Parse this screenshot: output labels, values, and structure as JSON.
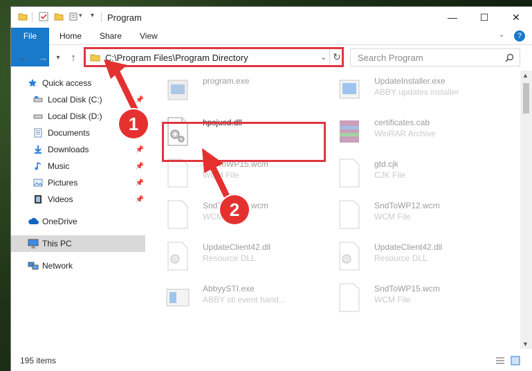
{
  "window": {
    "title": "Program",
    "minimize": "—",
    "maximize": "☐",
    "close": "✕"
  },
  "ribbon": {
    "tabs": [
      "File",
      "Home",
      "Share",
      "View"
    ],
    "help": "?"
  },
  "nav": {
    "back": "←",
    "forward": "→",
    "recent": "▾",
    "up": "↑",
    "address": "C:\\Program Files\\Program Directory",
    "search_placeholder": "Search Program"
  },
  "sidebar": {
    "items": [
      {
        "label": "Quick access",
        "icon": "star-icon"
      },
      {
        "label": "Local Disk (C:)",
        "icon": "drive-icon",
        "pinned": true
      },
      {
        "label": "Local Disk (D:)",
        "icon": "drive-icon",
        "pinned": false
      },
      {
        "label": "Documents",
        "icon": "documents-icon",
        "pinned": true
      },
      {
        "label": "Downloads",
        "icon": "download-icon",
        "pinned": true
      },
      {
        "label": "Music",
        "icon": "music-icon",
        "pinned": true
      },
      {
        "label": "Pictures",
        "icon": "pictures-icon",
        "pinned": true
      },
      {
        "label": "Videos",
        "icon": "videos-icon",
        "pinned": true
      },
      {
        "label": "OneDrive",
        "icon": "cloud-icon"
      },
      {
        "label": "This PC",
        "icon": "computer-icon",
        "selected": true
      },
      {
        "label": "Network",
        "icon": "network-icon"
      }
    ]
  },
  "files": [
    {
      "name": "program.exe",
      "desc": "",
      "icon": "exe-icon",
      "highlighted": false
    },
    {
      "name": "UpdateInstaller.exe",
      "desc": "ABBY updates installer",
      "icon": "installer-icon",
      "highlighted": false
    },
    {
      "name": "hpsjusd.dll",
      "desc": "",
      "icon": "dll-icon",
      "highlighted": true
    },
    {
      "name": "certificates.cab",
      "desc": "WinRAR Archive",
      "icon": "archive-icon",
      "highlighted": false
    },
    {
      "name": "SndToWP15.wcm",
      "desc": "WCM File",
      "icon": "file-icon",
      "highlighted": false
    },
    {
      "name": "gtd.cjk",
      "desc": "CJK File",
      "icon": "file-icon",
      "highlighted": false
    },
    {
      "name": "SndToWP12.wcm",
      "desc": "WCM File",
      "icon": "file-icon",
      "highlighted": false
    },
    {
      "name": "SndToWP12.wcm",
      "desc": "WCM File",
      "icon": "file-icon",
      "highlighted": false
    },
    {
      "name": "UpdateClient42.dll",
      "desc": "Resource DLL",
      "icon": "dll-icon",
      "highlighted": false
    },
    {
      "name": "UpdateClient42.dll",
      "desc": "Resource DLL",
      "icon": "dll-icon",
      "highlighted": false
    },
    {
      "name": "AbbyySTI.exe",
      "desc": "ABBY sti event hand...",
      "icon": "exe-icon",
      "highlighted": false
    },
    {
      "name": "SndToWP15.wcm",
      "desc": "WCM File",
      "icon": "file-icon",
      "highlighted": false
    }
  ],
  "status": {
    "count": "195 items"
  },
  "callouts": {
    "one": "1",
    "two": "2"
  },
  "colors": {
    "accent": "#1979ca",
    "highlight": "#e0363f",
    "badge": "#e4312f"
  }
}
